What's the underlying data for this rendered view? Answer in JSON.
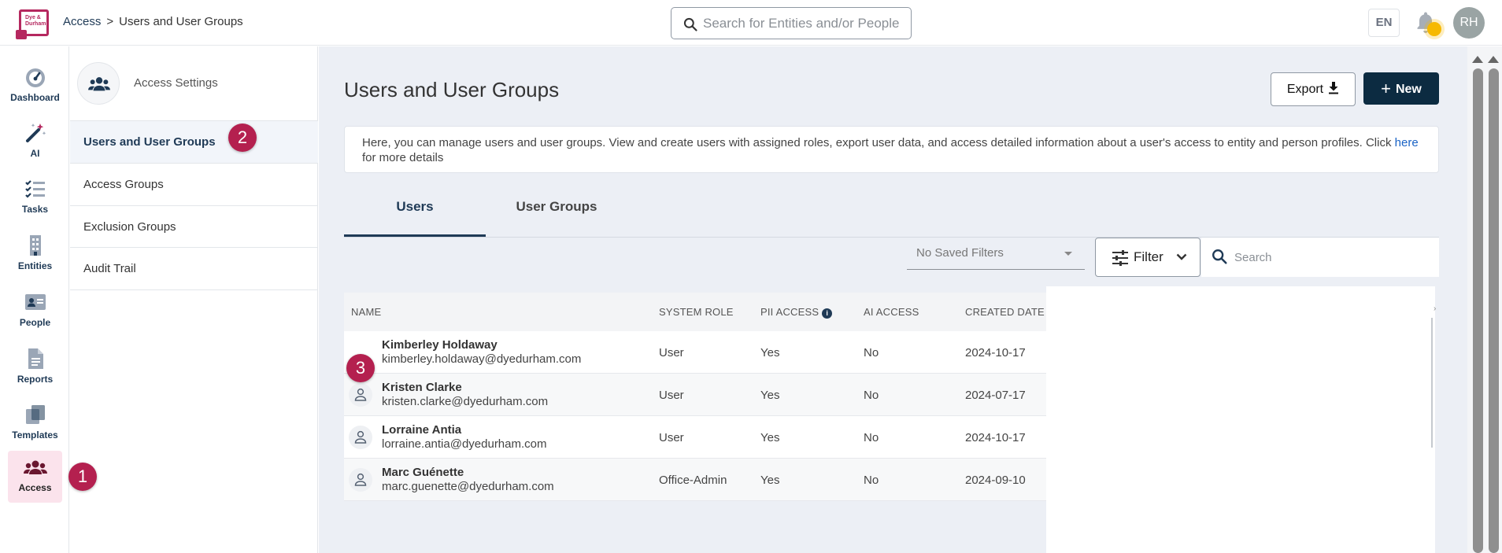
{
  "header": {
    "logo_text": "Dye & Durham",
    "breadcrumb": {
      "root": "Access",
      "separator": ">",
      "current": "Users and User Groups"
    },
    "search_placeholder": "Search for Entities and/or People",
    "language": "EN",
    "user_initials": "RH",
    "notification_color": "#f6b900"
  },
  "rail": {
    "items": [
      {
        "label": "Dashboard",
        "icon": "gauge-icon"
      },
      {
        "label": "AI",
        "icon": "magic-wand-icon"
      },
      {
        "label": "Tasks",
        "icon": "checklist-icon"
      },
      {
        "label": "Entities",
        "icon": "building-icon"
      },
      {
        "label": "People",
        "icon": "id-card-icon"
      },
      {
        "label": "Reports",
        "icon": "document-icon"
      },
      {
        "label": "Templates",
        "icon": "copy-icon"
      },
      {
        "label": "Access",
        "icon": "users-icon",
        "active": true
      }
    ],
    "active_color": "#fbe3ec"
  },
  "settings_panel": {
    "title": "Access Settings",
    "items": [
      {
        "label": "Users and User Groups",
        "active": true
      },
      {
        "label": "Access Groups"
      },
      {
        "label": "Exclusion Groups"
      },
      {
        "label": "Audit Trail"
      }
    ]
  },
  "main": {
    "title": "Users and User Groups",
    "export_label": "Export",
    "new_label": "New",
    "info_text": "Here, you can manage users and user groups. View and create users with assigned roles, export user data, and access detailed information about a user's access to entity and person profiles. Click",
    "info_link": "here",
    "info_tail": "for more details",
    "tabs": [
      {
        "label": "Users",
        "active": true
      },
      {
        "label": "User Groups"
      }
    ],
    "saved_filters": "No Saved Filters",
    "filter_label": "Filter",
    "search_placeholder": "Search",
    "table": {
      "columns": [
        "NAME",
        "SYSTEM ROLE",
        "PII ACCESS",
        "AI ACCESS",
        "CREATED DATE"
      ],
      "rows": [
        {
          "name": "Kimberley Holdaway",
          "email": "kimberley.holdaway@dyedurham.com",
          "role": "User",
          "pii": "Yes",
          "ai": "No",
          "created": "2024-10-17"
        },
        {
          "name": "Kristen Clarke",
          "email": "kristen.clarke@dyedurham.com",
          "role": "User",
          "pii": "Yes",
          "ai": "No",
          "created": "2024-07-17"
        },
        {
          "name": "Lorraine Antia",
          "email": "lorraine.antia@dyedurham.com",
          "role": "User",
          "pii": "Yes",
          "ai": "No",
          "created": "2024-10-17"
        },
        {
          "name": "Marc Guénette",
          "email": "marc.guenette@dyedurham.com",
          "role": "Office-Admin",
          "pii": "Yes",
          "ai": "No",
          "created": "2024-09-10"
        }
      ]
    }
  },
  "annotations": {
    "step_1": "1",
    "step_2": "2",
    "step_3": "3",
    "color": "#b4204f"
  },
  "colors": {
    "primary": "#0c2b41",
    "brand": "#b5285f",
    "link": "#1a63c5"
  }
}
